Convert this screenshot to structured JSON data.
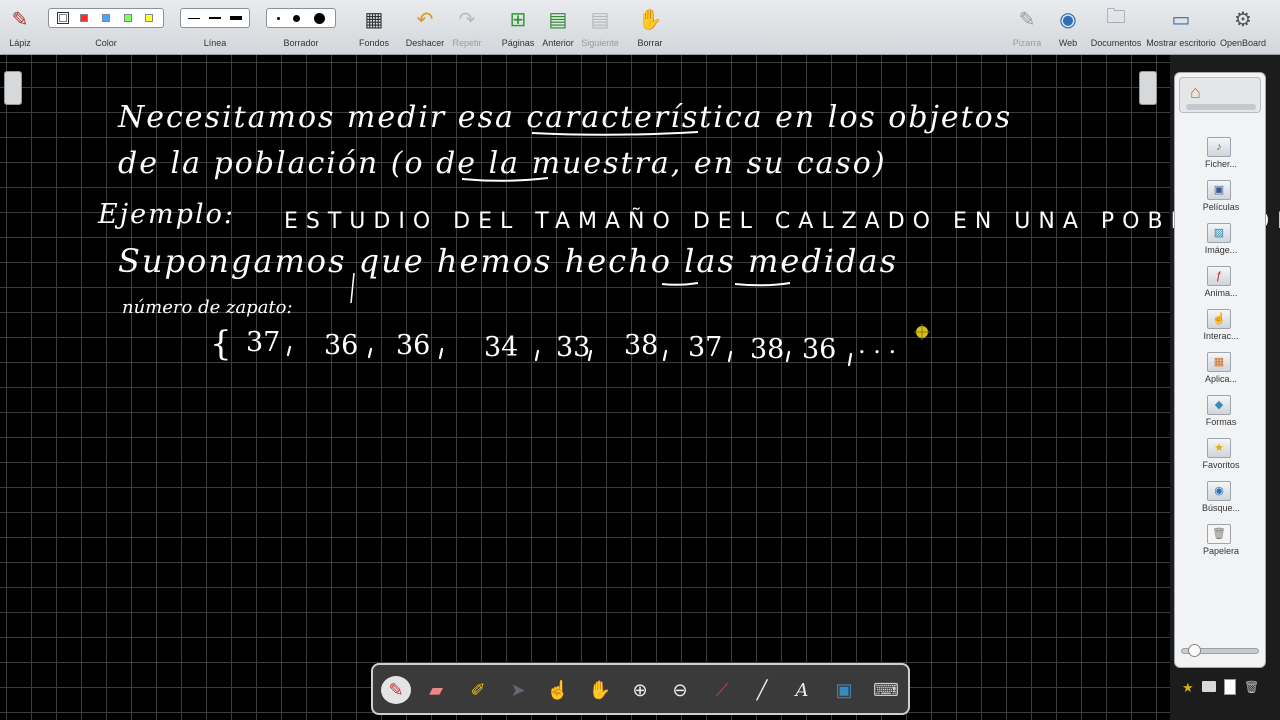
{
  "toolbar": {
    "pencil": "Lápiz",
    "color": "Color",
    "line": "Línea",
    "eraser": "Borrador",
    "backgrounds": "Fondos",
    "undo": "Deshacer",
    "redo": "Repetir",
    "pages": "Páginas",
    "previous": "Anterior",
    "next": "Siguiente",
    "clear": "Borrar",
    "board": "Pizarra",
    "web": "Web",
    "documents": "Documentos",
    "show_desktop": "Mostrar escritorio",
    "app": "OpenBoard",
    "colors": [
      "#ffffff",
      "#ff2a2a",
      "#44a8ff",
      "#7cff5a",
      "#ffff33"
    ]
  },
  "board": {
    "line1": "Necesitamos medir esa característica en los objetos",
    "line2": "de la población (o de la muestra, en su caso)",
    "example_label": "Ejemplo:",
    "example_text": "ESTUDIO DEL TAMAÑO DEL CALZADO EN UNA POBLACIÓN",
    "line4": "Supongamos que hemos hecho las medidas",
    "shoe_label": "número de zapato:",
    "open_brace": "{",
    "values": [
      "37",
      "36",
      "36",
      "34",
      "33",
      "38",
      "37",
      "38",
      "36"
    ],
    "ellipsis": ". . ."
  },
  "library": {
    "items": [
      "Ficher...",
      "Películas",
      "Imáge...",
      "Anima...",
      "Interac...",
      "Aplica...",
      "Formas",
      "Favoritos",
      "Búsque...",
      "Papelera"
    ]
  }
}
